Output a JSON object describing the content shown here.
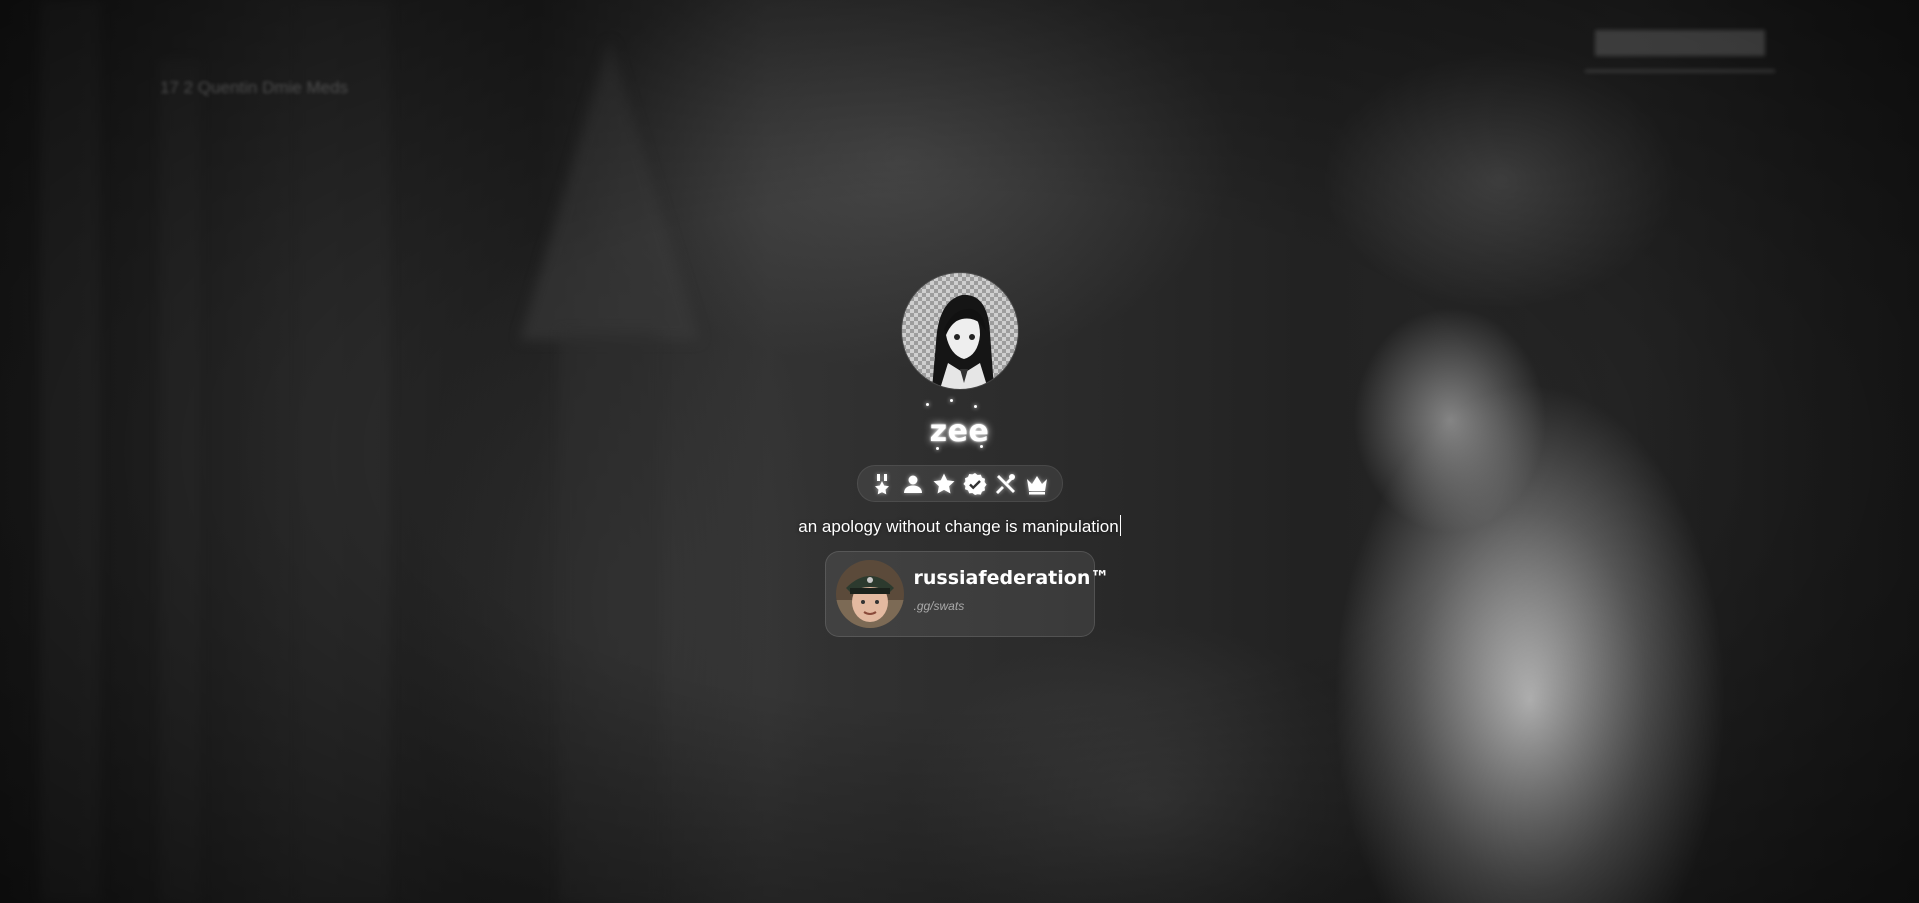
{
  "background": {
    "corner_note": "17    2   Quentin Dmie Meds",
    "theme": "dark monochrome gothic scene"
  },
  "profile": {
    "avatar_icon": "anime-girl-avatar",
    "username": "zee",
    "badges": [
      {
        "icon": "medal-icon",
        "label": "early supporter"
      },
      {
        "icon": "user-icon",
        "label": "member"
      },
      {
        "icon": "star-icon",
        "label": "star"
      },
      {
        "icon": "verified-icon",
        "label": "verified"
      },
      {
        "icon": "tools-icon",
        "label": "developer"
      },
      {
        "icon": "crown-icon",
        "label": "owner"
      }
    ],
    "bio": "an apology without change is manipulation"
  },
  "discord": {
    "name": "russiafederation™",
    "status": ".gg/swats",
    "avatar_icon": "child-in-cap-avatar"
  },
  "colors": {
    "text": "#ffffff",
    "card_bg": "rgba(255,255,255,0.08)"
  }
}
